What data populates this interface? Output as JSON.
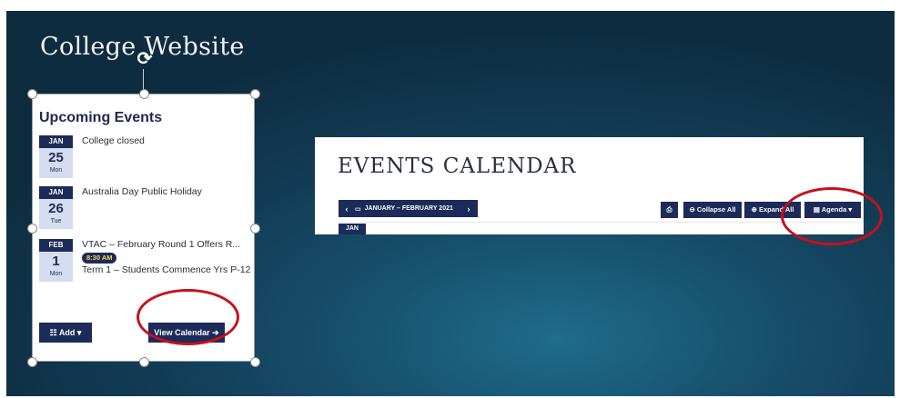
{
  "slide": {
    "title": "College Website"
  },
  "widget": {
    "title": "Upcoming Events",
    "events": [
      {
        "month": "JAN",
        "day": "25",
        "weekday": "Mon",
        "title": "College closed"
      },
      {
        "month": "JAN",
        "day": "26",
        "weekday": "Tue",
        "title": "Australia Day Public Holiday"
      },
      {
        "month": "FEB",
        "day": "1",
        "weekday": "Mon",
        "title": "VTAC – February Round 1 Offers R...",
        "time": "8:30 AM",
        "title2": "Term 1 – Students Commence Yrs P-12"
      }
    ],
    "add_label": "Add",
    "view_calendar_label": "View Calendar"
  },
  "calendar": {
    "title": "EVENTS CALENDAR",
    "date_range": "JANUARY – FEBRUARY 2021",
    "collapse_label": "Collapse All",
    "expand_label": "Expand All",
    "agenda_label": "Agenda",
    "row_month": "JAN"
  },
  "colors": {
    "navy": "#1d2b5a",
    "highlight_circle": "#c8101c",
    "time_badge_text": "#ffd84a"
  }
}
